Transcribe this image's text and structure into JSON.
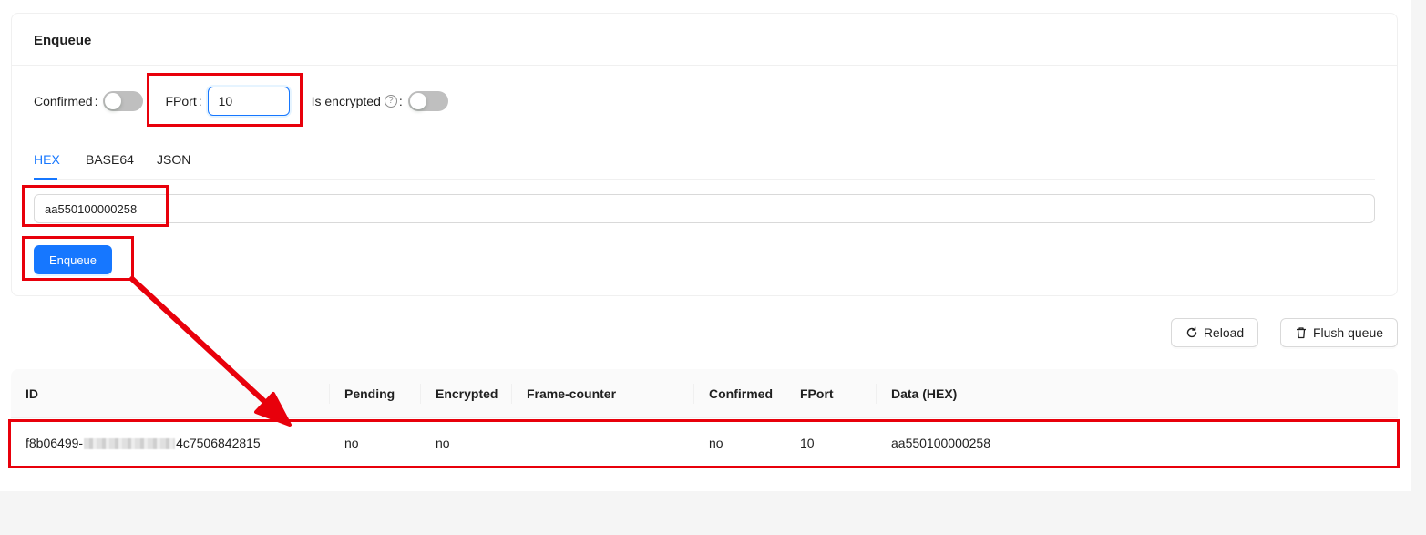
{
  "enqueue_card": {
    "title": "Enqueue",
    "confirmed_label": "Confirmed",
    "confirmed_on": false,
    "fport_label": "FPort",
    "fport_value": "10",
    "encrypted_label": "Is encrypted",
    "encrypted_on": false,
    "label_colon": ":",
    "tabs": [
      {
        "label": "HEX",
        "active": true
      },
      {
        "label": "BASE64",
        "active": false
      },
      {
        "label": "JSON",
        "active": false
      }
    ],
    "payload_value": "aa550100000258",
    "submit_label": "Enqueue"
  },
  "toolbar": {
    "reload_label": "Reload",
    "flush_label": "Flush queue"
  },
  "table": {
    "columns": [
      "ID",
      "Pending",
      "Encrypted",
      "Frame-counter",
      "Confirmed",
      "FPort",
      "Data (HEX)"
    ],
    "rows": [
      {
        "id_prefix": "f8b06499-",
        "id_suffix": "4c7506842815",
        "pending": "no",
        "encrypted": "no",
        "frame_counter": "",
        "confirmed": "no",
        "fport": "10",
        "data_hex": "aa550100000258"
      }
    ]
  },
  "colors": {
    "primary": "#1677ff",
    "annotation": "#e8000b"
  }
}
